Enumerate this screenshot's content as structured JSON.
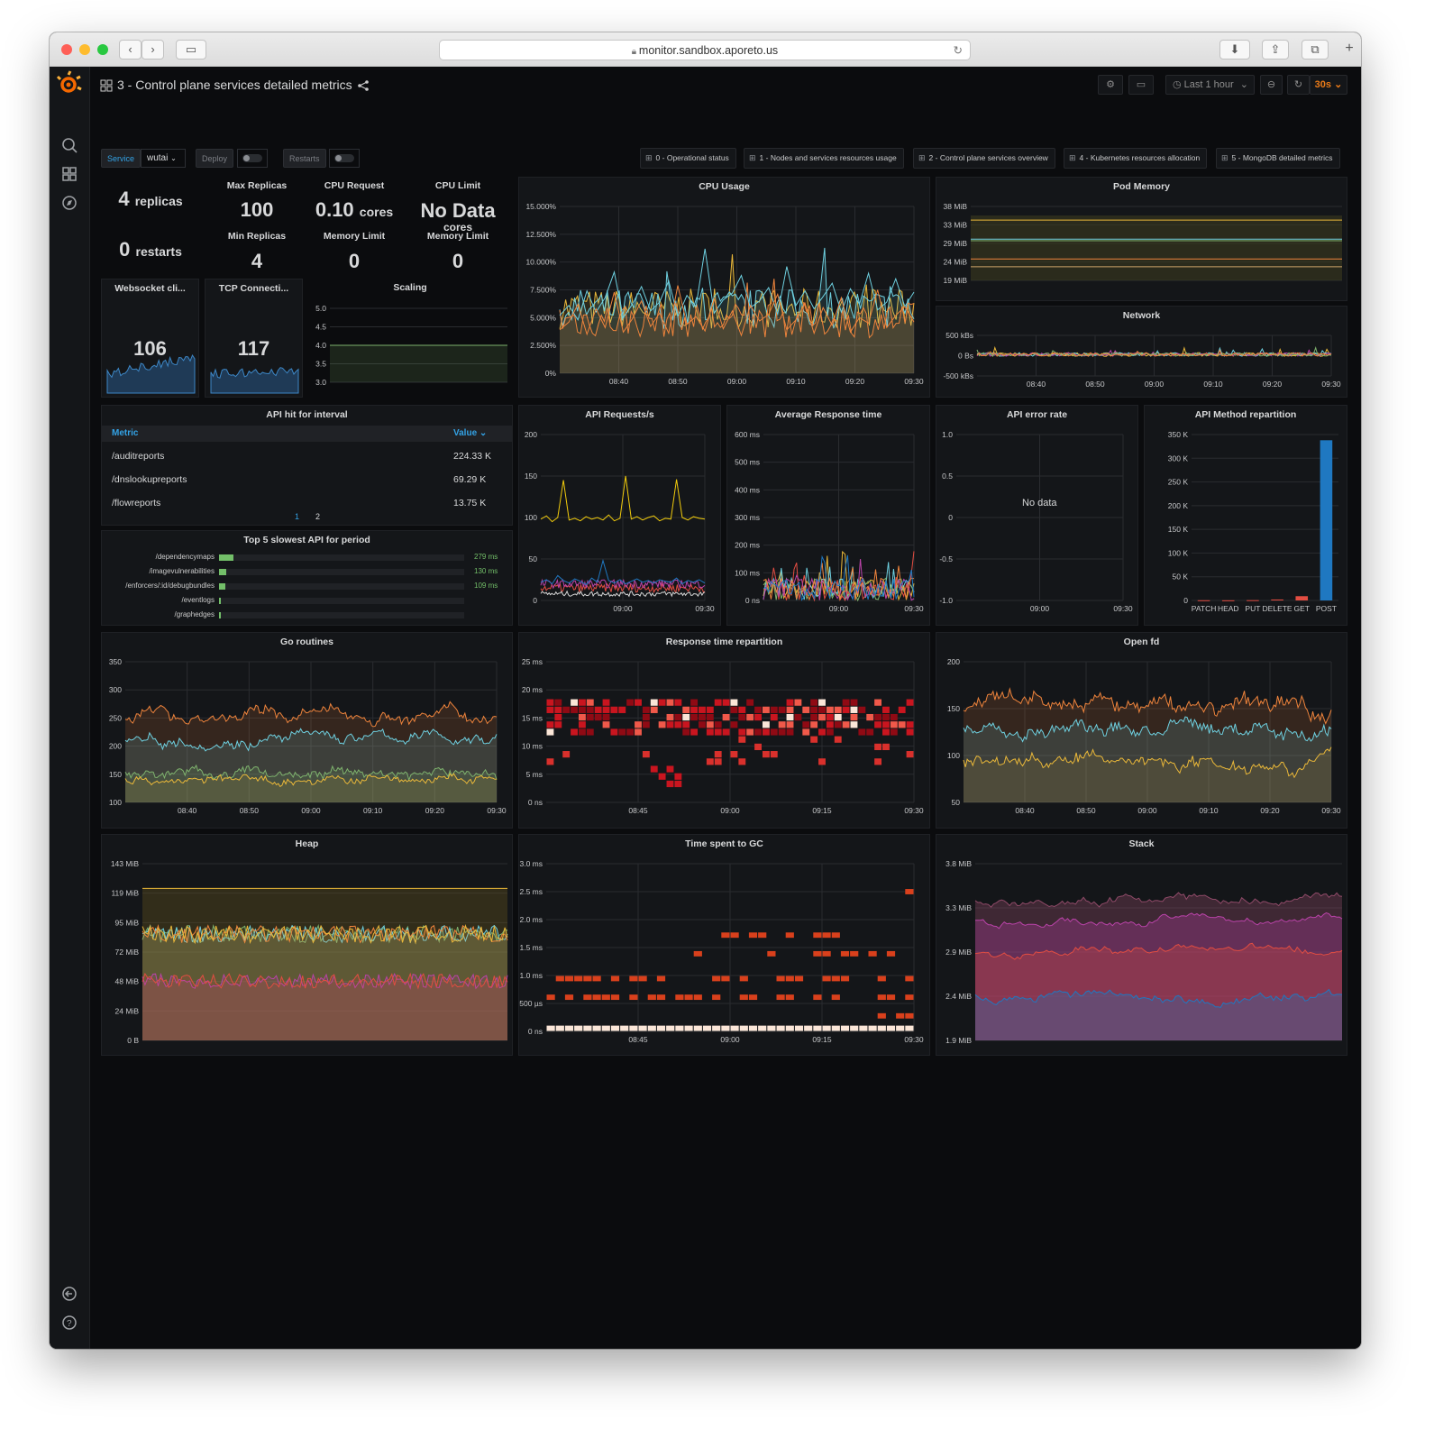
{
  "browser": {
    "url": "monitor.sandbox.aporeto.us"
  },
  "dashboard": {
    "title": "3 - Control plane services detailed metrics",
    "time_range": "Last 1 hour",
    "refresh": "30s"
  },
  "vars": {
    "service_label": "Service",
    "service_value": "wutai",
    "deploy_label": "Deploy",
    "restarts_label": "Restarts"
  },
  "links": [
    "0 - Operational status",
    "1 - Nodes and services resources usage",
    "2 - Control plane services overview",
    "4 - Kubernetes resources allocation",
    "5 - MongoDB detailed metrics"
  ],
  "stats": {
    "replicas_value": "4",
    "replicas_unit": "replicas",
    "restarts_value": "0",
    "restarts_unit": "restarts",
    "max_replicas_title": "Max Replicas",
    "max_replicas": "100",
    "min_replicas_title": "Min Replicas",
    "min_replicas": "4",
    "cpu_request_title": "CPU Request",
    "cpu_request": "0.10",
    "cpu_request_unit": "cores",
    "cpu_limit_title": "CPU Limit",
    "cpu_limit": "No Data",
    "cpu_limit_unit": "cores",
    "memory_limit_title": "Memory Limit",
    "memory_limit": "0",
    "memory_limit2_title": "Memory Limit",
    "memory_limit2": "0",
    "websocket_title": "Websocket cli...",
    "websocket": "106",
    "tcp_title": "TCP Connecti...",
    "tcp": "117",
    "scaling_title": "Scaling"
  },
  "api_hits": {
    "title": "API hit for interval",
    "col_metric": "Metric",
    "col_value": "Value",
    "rows": [
      {
        "metric": "/auditreports",
        "value": "224.33 K"
      },
      {
        "metric": "/dnslookupreports",
        "value": "69.29 K"
      },
      {
        "metric": "/flowreports",
        "value": "13.75 K"
      }
    ],
    "pages": [
      "1",
      "2"
    ]
  },
  "slowest": {
    "title": "Top 5 slowest API for period",
    "rows": [
      {
        "name": "/dependencymaps",
        "value": "279 ms",
        "frac": 0.06
      },
      {
        "name": "/imagevulnerabilities",
        "value": "130 ms",
        "frac": 0.03
      },
      {
        "name": "/enforcers/:id/debugbundles",
        "value": "109 ms",
        "frac": 0.025
      },
      {
        "name": "/eventlogs",
        "value": "",
        "frac": 0.005
      },
      {
        "name": "/graphedges",
        "value": "",
        "frac": 0.005
      }
    ]
  },
  "panel_titles": {
    "cpu": "CPU Usage",
    "pod_memory": "Pod Memory",
    "network": "Network",
    "api_req": "API Requests/s",
    "avg_resp": "Average Response time",
    "api_err": "API error rate",
    "api_method": "API Method repartition",
    "go_routines": "Go routines",
    "resp_hist": "Response time repartition",
    "open_fd": "Open fd",
    "heap": "Heap",
    "gc": "Time spent to GC",
    "stack": "Stack"
  },
  "api_err_nodata": "No data",
  "colors": {
    "green": "#7eb26d",
    "yellow": "#eab839",
    "cyan": "#6ed0e0",
    "orange": "#ef843c",
    "red": "#e24d42",
    "blue": "#1f78c1",
    "purple": "#ba43a9",
    "bar_blue": "#1f78c1",
    "grafana_orange": "#f46800",
    "bg": "#0b0c0e",
    "panel": "#141619"
  },
  "chart_data": [
    {
      "id": "cpu",
      "type": "line",
      "title": "CPU Usage",
      "yticks": [
        "15.000%",
        "12.500%",
        "10.000%",
        "7.500%",
        "5.000%",
        "2.500%",
        "0%"
      ],
      "xticks": [
        "08:40",
        "08:50",
        "09:00",
        "09:10",
        "09:20",
        "09:30"
      ],
      "series": [
        {
          "values": [
            5.2,
            6.1,
            4.8,
            7.4,
            5.5,
            6.8,
            9.1,
            5.0,
            6.2,
            7.8,
            5.6,
            6.4,
            8.3,
            5.1,
            7.0,
            6.0,
            11.2,
            5.4,
            6.6,
            7.2,
            8.8,
            5.9,
            6.5,
            7.7,
            5.3,
            9.6,
            6.1,
            7.4,
            5.8,
            6.9,
            8.1,
            5.5,
            7.6,
            6.2,
            9.0,
            5.7,
            6.4,
            8.5,
            6.0,
            7.3
          ]
        },
        {
          "values": [
            3.9,
            4.6,
            6.2,
            3.5,
            5.8,
            4.1,
            7.3,
            3.7,
            4.9,
            6.5,
            4.2,
            5.4,
            3.6,
            7.9,
            4.4,
            5.1,
            3.8,
            6.7,
            4.0,
            5.6,
            3.4,
            6.1,
            4.7,
            5.3,
            7.1,
            3.9,
            4.8,
            6.3,
            3.6,
            5.9,
            4.3,
            6.8,
            3.7,
            5.0,
            4.5,
            7.5,
            4.1,
            5.2,
            6.0,
            4.6
          ]
        }
      ]
    },
    {
      "id": "pod_memory",
      "type": "line",
      "title": "Pod Memory",
      "yticks": [
        "38 MiB",
        "33 MiB",
        "29 MiB",
        "24 MiB",
        "19 MiB"
      ],
      "series": [
        {
          "values": [
            34.5,
            34.5
          ]
        },
        {
          "values": [
            29.6,
            29.6
          ]
        },
        {
          "values": [
            29.2,
            29.2
          ]
        },
        {
          "values": [
            24.5,
            24.5
          ]
        },
        {
          "values": [
            22.5,
            22.5
          ]
        }
      ]
    },
    {
      "id": "network",
      "type": "line",
      "title": "Network",
      "yticks": [
        "500 kBs",
        "0 Bs",
        "-500 kBs"
      ],
      "xticks": [
        "08:40",
        "08:50",
        "09:00",
        "09:10",
        "09:20",
        "09:30"
      ]
    },
    {
      "id": "scaling",
      "type": "line",
      "title": "Scaling",
      "yticks": [
        "5.0",
        "4.5",
        "4.0",
        "3.5",
        "3.0"
      ],
      "series": [
        {
          "values": [
            4,
            4
          ]
        }
      ]
    },
    {
      "id": "api_req",
      "type": "line",
      "title": "API Requests/s",
      "yticks": [
        "200",
        "150",
        "100",
        "50",
        "0"
      ],
      "xticks": [
        "09:00",
        "09:30"
      ],
      "series": [
        {
          "values": [
            98,
            102,
            95,
            100,
            145,
            97,
            99,
            96,
            101,
            98,
            100,
            97,
            103,
            96,
            99,
            150,
            98,
            101,
            97,
            100,
            102,
            96,
            99,
            98,
            146,
            100,
            97,
            101,
            99,
            98
          ]
        },
        {
          "values": [
            22,
            25,
            20,
            30,
            24,
            21,
            26,
            23,
            19,
            27,
            22,
            48,
            24,
            21,
            25,
            20,
            23,
            26,
            22,
            24,
            21,
            25,
            23,
            22,
            27,
            20,
            24,
            22,
            25,
            21
          ]
        }
      ]
    },
    {
      "id": "avg_resp",
      "type": "line",
      "title": "Average Response time",
      "yticks": [
        "600 ms",
        "500 ms",
        "400 ms",
        "300 ms",
        "200 ms",
        "100 ms",
        "0 ns"
      ],
      "xticks": [
        "09:00",
        "09:30"
      ]
    },
    {
      "id": "api_err",
      "type": "line",
      "title": "API error rate",
      "yticks": [
        "1.0",
        "0.5",
        "0",
        "-0.5",
        "-1.0"
      ],
      "xticks": [
        "09:00",
        "09:30"
      ]
    },
    {
      "id": "api_method",
      "type": "bar",
      "title": "API Method repartition",
      "yticks": [
        "350 K",
        "300 K",
        "250 K",
        "200 K",
        "150 K",
        "100 K",
        "50 K",
        "0"
      ],
      "categories": [
        "PATCH",
        "HEAD",
        "PUT",
        "DELETE",
        "GET",
        "POST"
      ],
      "values": [
        400,
        300,
        600,
        2000,
        9000,
        338000
      ],
      "ylim": [
        0,
        350000
      ]
    },
    {
      "id": "go_routines",
      "type": "line",
      "title": "Go routines",
      "yticks": [
        "350",
        "300",
        "250",
        "200",
        "150",
        "100"
      ],
      "xticks": [
        "08:40",
        "08:50",
        "09:00",
        "09:10",
        "09:20",
        "09:30"
      ]
    },
    {
      "id": "resp_hist",
      "type": "heatmap",
      "title": "Response time repartition",
      "yticks": [
        "25 ms",
        "20 ms",
        "15 ms",
        "10 ms",
        "5 ms",
        "0 ns"
      ],
      "xticks": [
        "08:45",
        "09:00",
        "09:15",
        "09:30"
      ]
    },
    {
      "id": "open_fd",
      "type": "line",
      "title": "Open fd",
      "yticks": [
        "200",
        "150",
        "100",
        "50"
      ],
      "xticks": [
        "08:40",
        "08:50",
        "09:00",
        "09:10",
        "09:20",
        "09:30"
      ]
    },
    {
      "id": "heap",
      "type": "area",
      "title": "Heap",
      "yticks": [
        "143 MiB",
        "119 MiB",
        "95 MiB",
        "72 MiB",
        "48 MiB",
        "24 MiB",
        "0 B"
      ]
    },
    {
      "id": "gc",
      "type": "heatmap",
      "title": "Time spent to GC",
      "yticks": [
        "3.0 ms",
        "2.5 ms",
        "2.0 ms",
        "1.5 ms",
        "1.0 ms",
        "500 µs",
        "0 ns"
      ],
      "xticks": [
        "08:45",
        "09:00",
        "09:15",
        "09:30"
      ]
    },
    {
      "id": "stack",
      "type": "area",
      "title": "Stack",
      "yticks": [
        "3.8 MiB",
        "3.3 MiB",
        "2.9 MiB",
        "2.4 MiB",
        "1.9 MiB"
      ]
    }
  ]
}
